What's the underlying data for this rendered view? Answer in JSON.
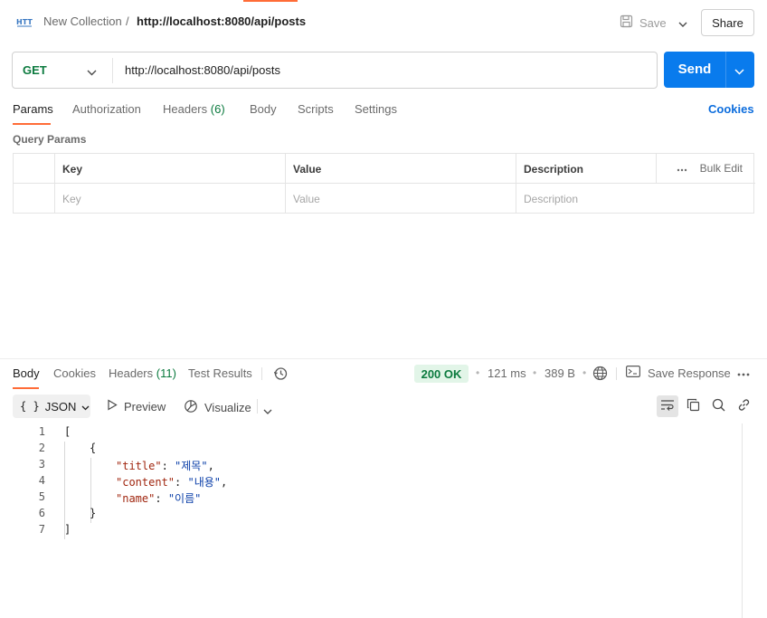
{
  "header": {
    "collection": "New Collection",
    "separator": "/",
    "request_name": "http://localhost:8080/api/posts",
    "save_label": "Save",
    "share_label": "Share"
  },
  "request": {
    "method": "GET",
    "url": "http://localhost:8080/api/posts",
    "send_label": "Send"
  },
  "request_tabs": {
    "params": "Params",
    "authorization": "Authorization",
    "headers": "Headers",
    "headers_count": "(6)",
    "body": "Body",
    "scripts": "Scripts",
    "settings": "Settings",
    "cookies": "Cookies"
  },
  "query_params": {
    "title": "Query Params",
    "columns": [
      "Key",
      "Value",
      "Description"
    ],
    "bulk_edit": "Bulk Edit",
    "placeholders": [
      "Key",
      "Value",
      "Description"
    ]
  },
  "response": {
    "tabs": {
      "body": "Body",
      "cookies": "Cookies",
      "headers": "Headers",
      "headers_count": "(11)",
      "test_results": "Test Results"
    },
    "status": "200 OK",
    "time": "121 ms",
    "size": "389 B",
    "save_response": "Save Response",
    "format": "JSON",
    "format_braces": "{ }",
    "preview": "Preview",
    "visualize": "Visualize",
    "line_numbers": [
      "1",
      "2",
      "3",
      "4",
      "5",
      "6",
      "7"
    ],
    "body_lines": {
      "open_bracket": "[",
      "open_brace": "{",
      "title_key": "\"title\"",
      "title_value": "\"제목\"",
      "content_key": "\"content\"",
      "content_value": "\"내용\"",
      "name_key": "\"name\"",
      "name_value": "\"이름\"",
      "colon": ": ",
      "comma": ",",
      "close_brace": "}",
      "close_bracket": "]"
    }
  },
  "colors": {
    "accent": "#ff6c37",
    "send": "#097bed",
    "method_get": "#0b7a3e",
    "status_ok_bg": "#e2f5e8",
    "link": "#0c6ddd"
  }
}
